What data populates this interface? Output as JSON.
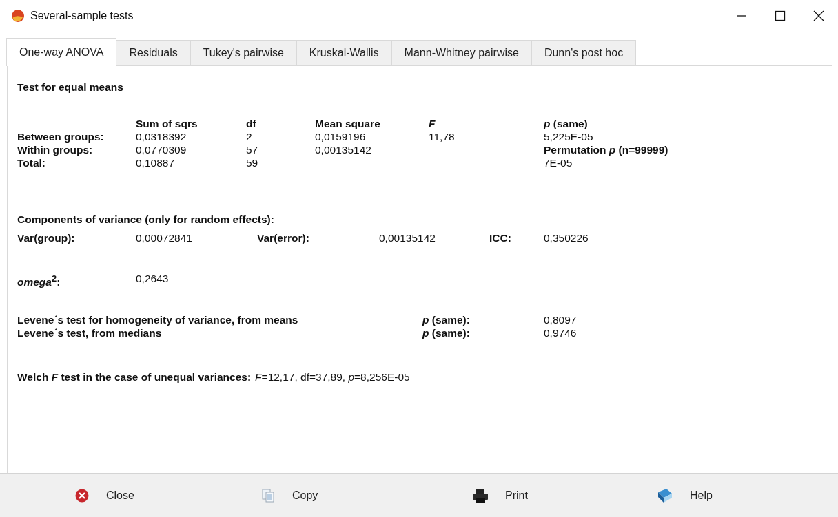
{
  "window": {
    "title": "Several-sample tests"
  },
  "tabs": [
    {
      "label": "One-way ANOVA",
      "selected": true
    },
    {
      "label": "Residuals",
      "selected": false
    },
    {
      "label": "Tukey's pairwise",
      "selected": false
    },
    {
      "label": "Kruskal-Wallis",
      "selected": false
    },
    {
      "label": "Mann-Whitney pairwise",
      "selected": false
    },
    {
      "label": "Dunn's post hoc",
      "selected": false
    }
  ],
  "heading": "Test for equal means",
  "anova_table": {
    "columns": [
      {
        "text": "Sum of sqrs"
      },
      {
        "text": "df"
      },
      {
        "text": "Mean square"
      },
      {
        "text": "F",
        "italic": true
      },
      {
        "text": "*p* (same)"
      }
    ],
    "rows": [
      {
        "label": "Between groups:",
        "cells": [
          {
            "text": "0,0318392"
          },
          {
            "text": "2"
          },
          {
            "text": "0,0159196"
          },
          {
            "text": "11,78"
          },
          {
            "text": "5,225E-05"
          }
        ]
      },
      {
        "label": "Within groups:",
        "cells": [
          {
            "text": "0,0770309"
          },
          {
            "text": "57"
          },
          {
            "text": "0,00135142"
          },
          null,
          {
            "text": "Permutation *p* (n=99999)",
            "bold": true
          }
        ]
      },
      {
        "label": "Total:",
        "cells": [
          {
            "text": "0,10887"
          },
          {
            "text": "59"
          },
          null,
          null,
          {
            "text": "7E-05"
          }
        ]
      }
    ]
  },
  "components": {
    "title": "Components of variance (only for random effects):",
    "items": [
      {
        "label": "Var(group):",
        "value": "0,00072841"
      },
      {
        "label": "Var(error):",
        "value": "0,00135142"
      },
      {
        "label": "ICC:",
        "value": "0,350226"
      }
    ]
  },
  "omega": {
    "label": "*omega*$^{2}$:",
    "value": "0,2643"
  },
  "levene": [
    {
      "label": "Levene´s test for homogeneity of variance, from means",
      "p_label": "*p* (same):",
      "value": "0,8097"
    },
    {
      "label": "Levene´s test, from medians",
      "p_label": "*p* (same):",
      "value": "0,9746"
    }
  ],
  "welch": {
    "label": "Welch *F* test in the case of unequal variances:",
    "value": "*F*=12,17, df=37,89, *p*=8,256E-05"
  },
  "buttons": [
    {
      "kind": "close",
      "label": "Close"
    },
    {
      "kind": "copy",
      "label": "Copy"
    },
    {
      "kind": "print",
      "label": "Print"
    },
    {
      "kind": "help",
      "label": "Help"
    }
  ]
}
